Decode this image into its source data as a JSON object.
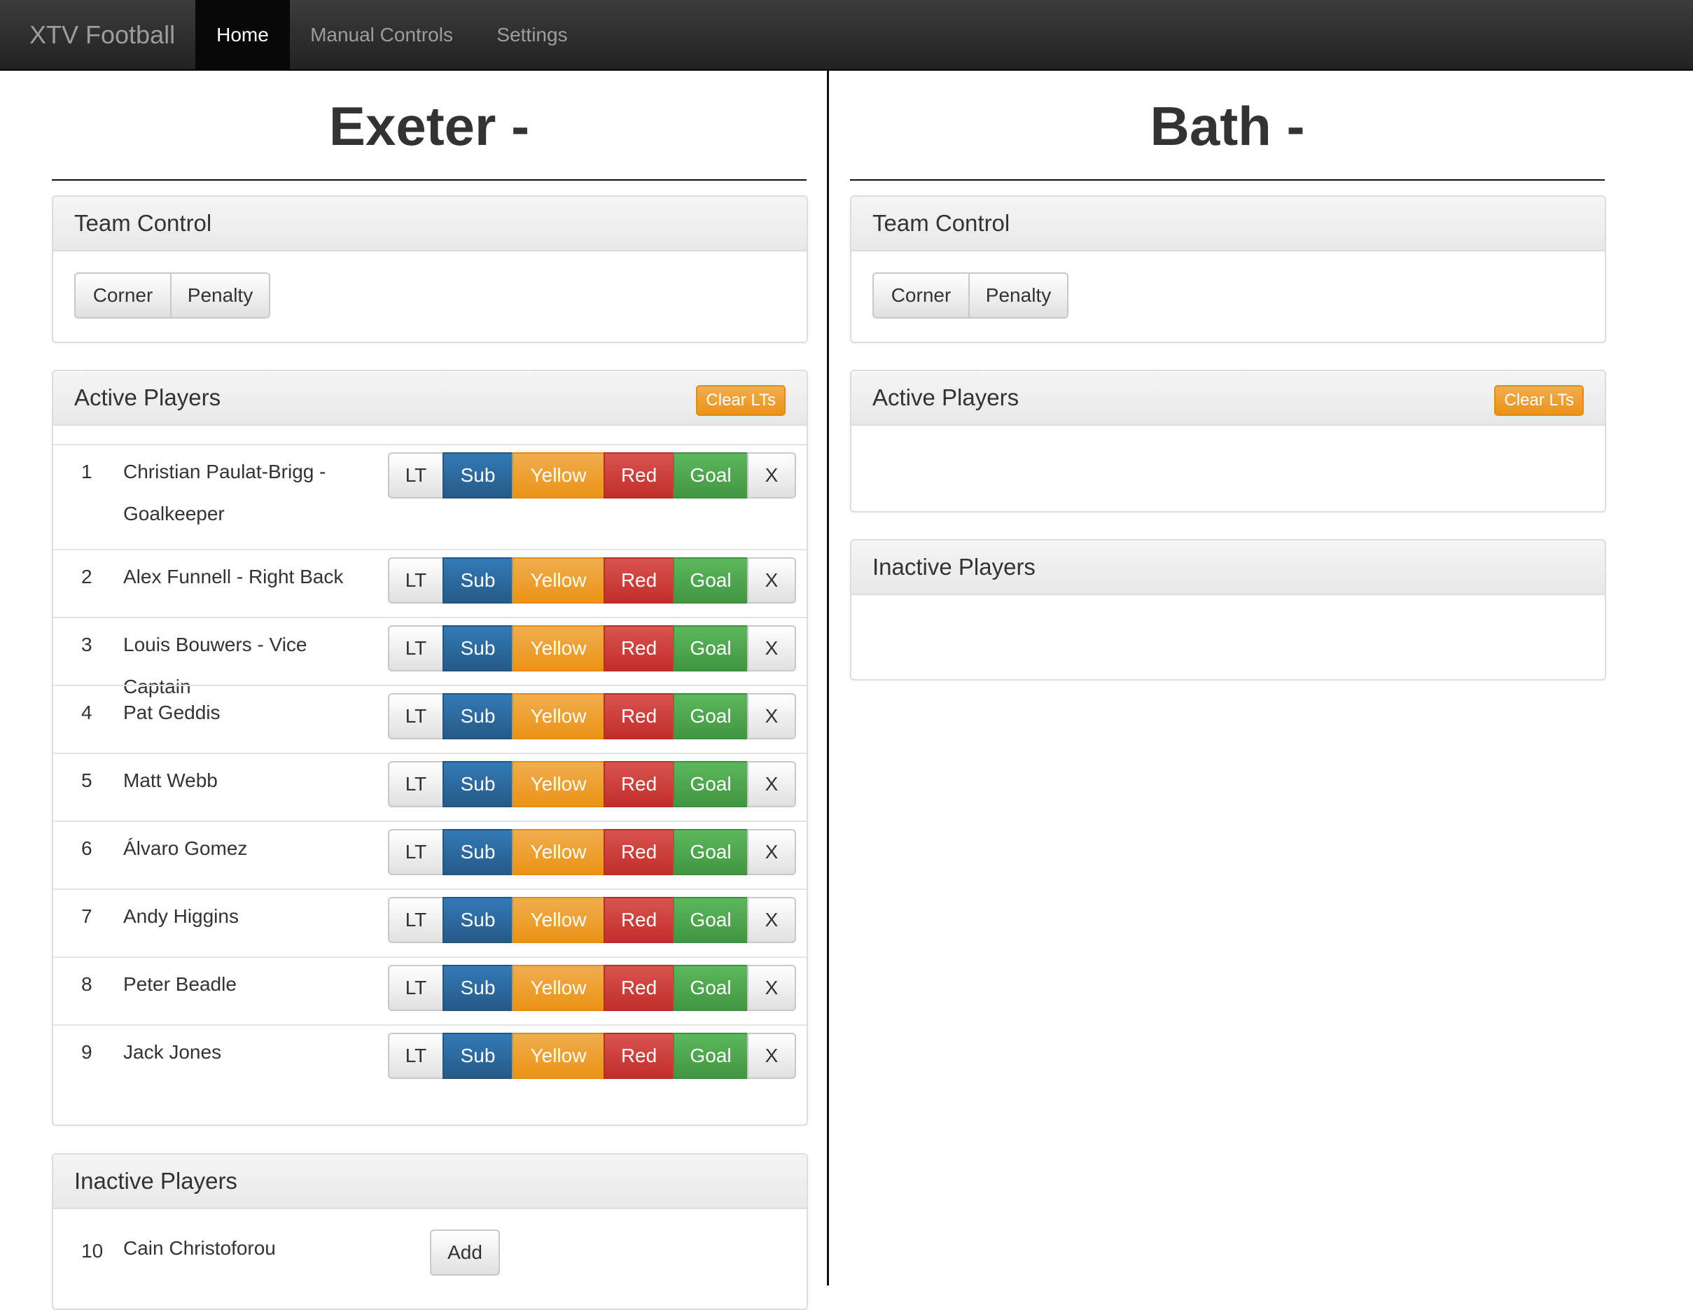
{
  "navbar": {
    "brand": "XTV Football",
    "items": [
      "Home",
      "Manual Controls",
      "Settings"
    ]
  },
  "home": {
    "title": "Exeter -",
    "team_control": {
      "title": "Team Control",
      "corner": "Corner",
      "penalty": "Penalty"
    },
    "active_players": {
      "title": "Active Players",
      "clear_label": "Clear LTs",
      "players": [
        {
          "num": "1",
          "name": "Christian Paulat-Brigg - Goalkeeper"
        },
        {
          "num": "2",
          "name": "Alex Funnell - Right Back"
        },
        {
          "num": "3",
          "name": "Louis Bouwers - Vice Captain"
        },
        {
          "num": "4",
          "name": "Pat Geddis"
        },
        {
          "num": "5",
          "name": "Matt Webb"
        },
        {
          "num": "6",
          "name": "Álvaro Gomez"
        },
        {
          "num": "7",
          "name": "Andy Higgins"
        },
        {
          "num": "8",
          "name": "Peter Beadle"
        },
        {
          "num": "9",
          "name": "Jack Jones"
        }
      ]
    },
    "inactive_players": {
      "title": "Inactive Players",
      "add_label": "Add",
      "players": [
        {
          "num": "10",
          "name": "Cain Christoforou"
        }
      ]
    }
  },
  "away": {
    "title": "Bath -",
    "team_control": {
      "title": "Team Control",
      "corner": "Corner",
      "penalty": "Penalty"
    },
    "active_players": {
      "title": "Active Players",
      "clear_label": "Clear LTs"
    },
    "inactive_players": {
      "title": "Inactive Players"
    }
  },
  "player_buttons": {
    "lt": "LT",
    "sub": "Sub",
    "yellow": "Yellow",
    "red": "Red",
    "goal": "Goal",
    "remove": "X"
  },
  "colors": {
    "navbar": "#222222",
    "primary": "#337ab7",
    "warning": "#f0ad4e",
    "danger": "#d9534f",
    "success": "#5cb85c"
  }
}
